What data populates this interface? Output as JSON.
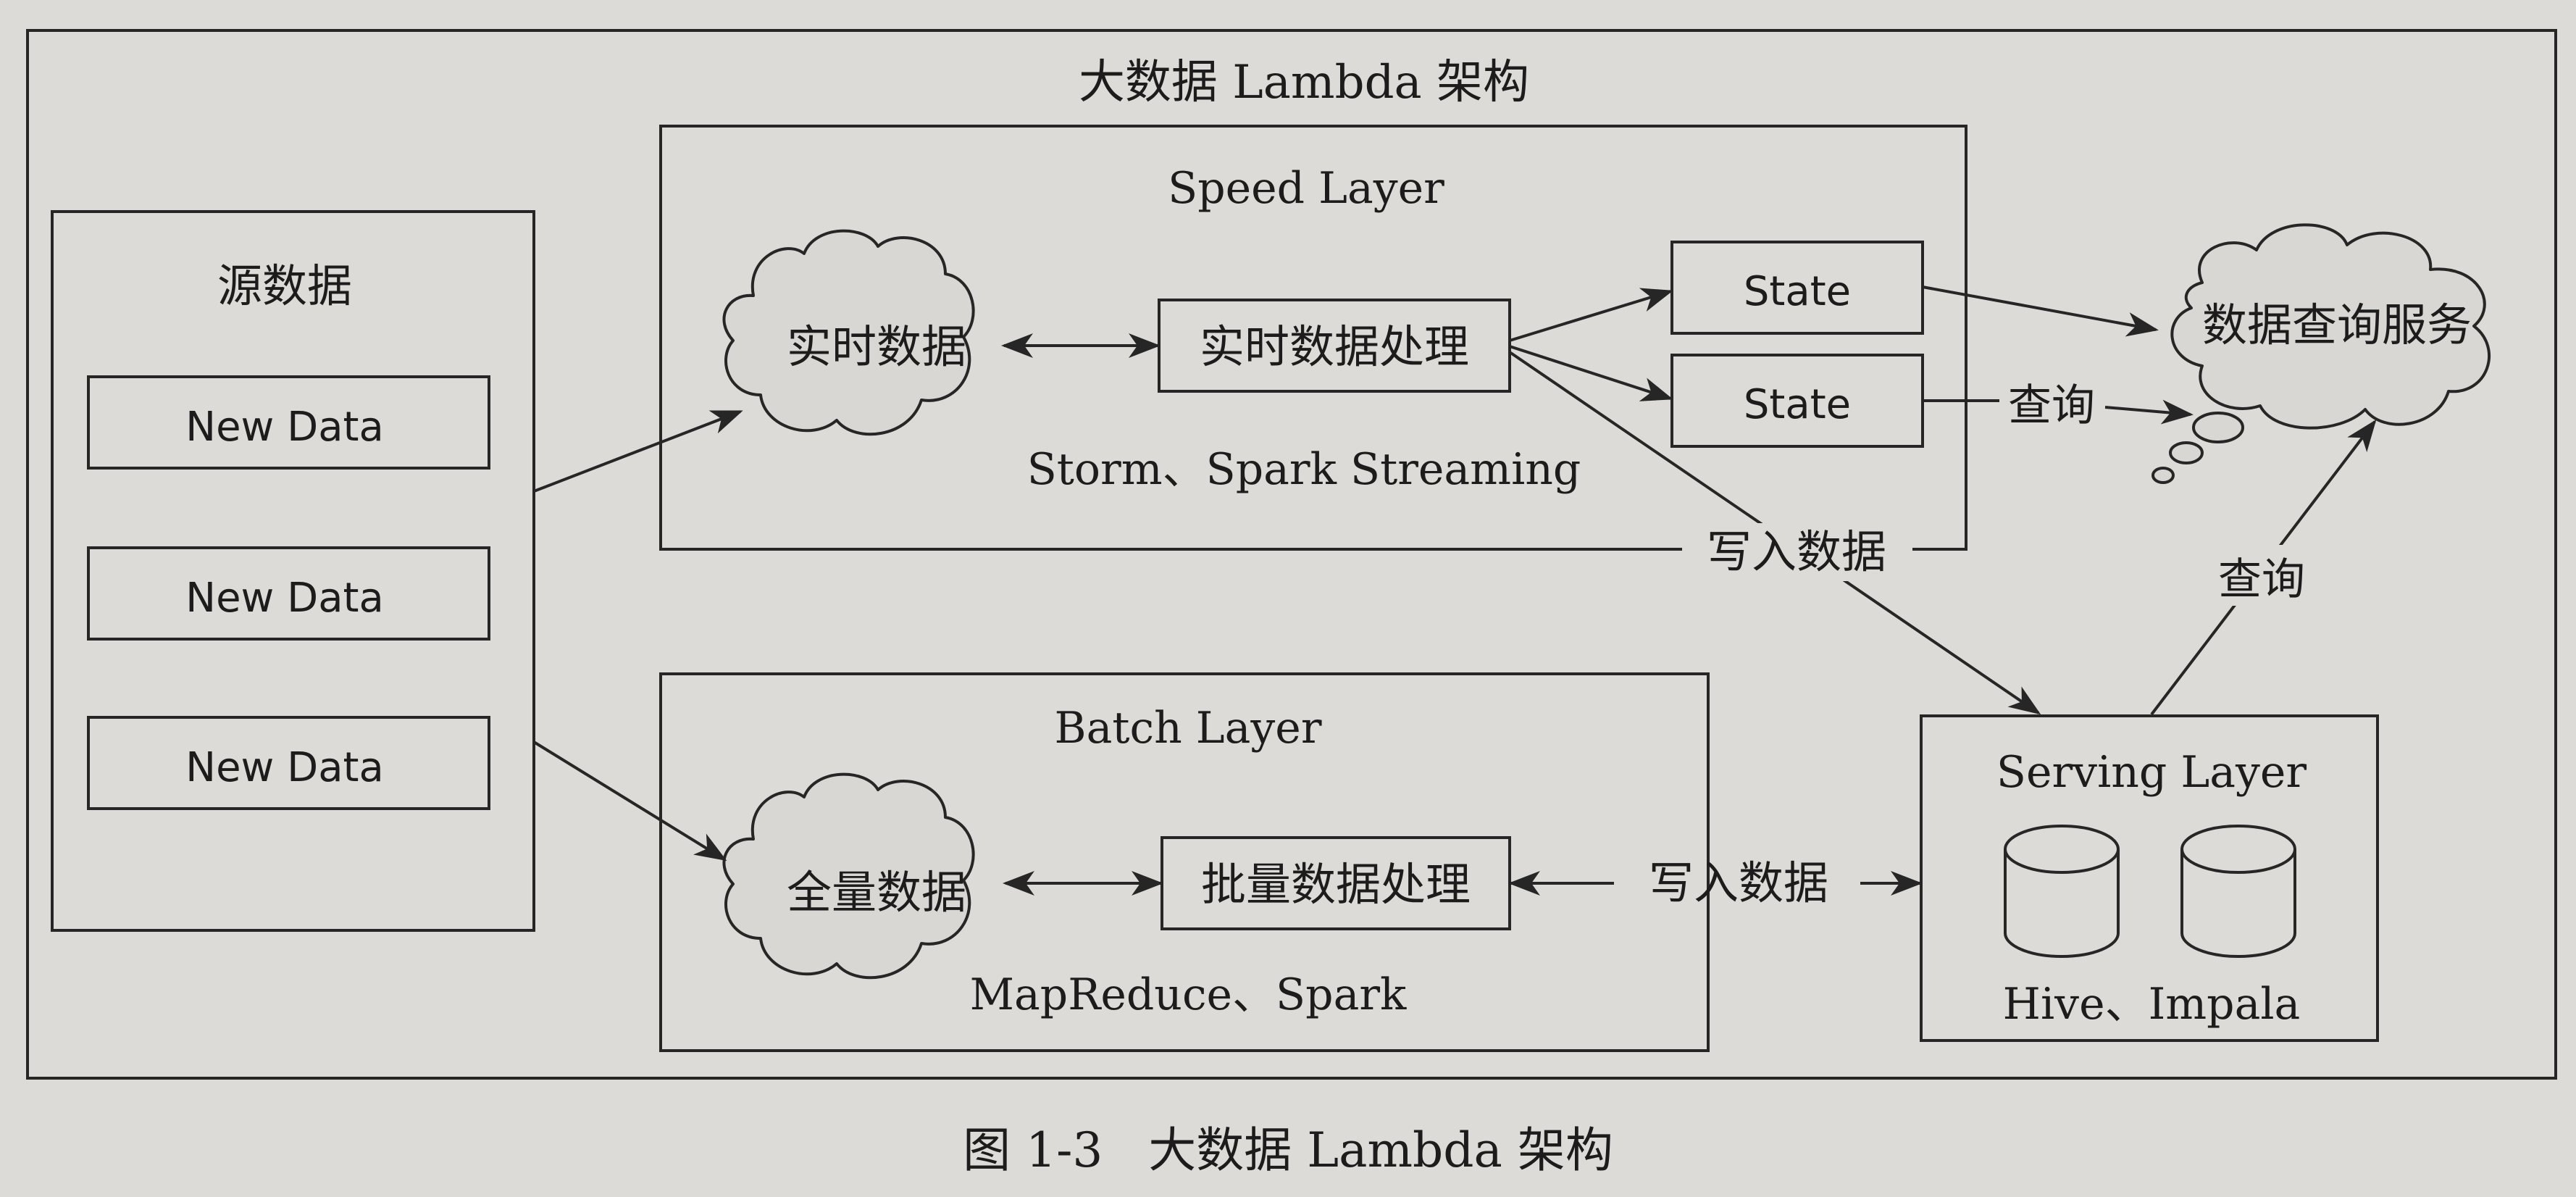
{
  "diagram": {
    "title": "大数据 Lambda 架构",
    "caption": "图 1-3   大数据 Lambda 架构",
    "source": {
      "title": "源数据",
      "items": [
        "New Data",
        "New Data",
        "New Data"
      ]
    },
    "speed_layer": {
      "title": "Speed Layer",
      "cloud_label": "实时数据",
      "process_label": "实时数据处理",
      "tech_label": "Storm、Spark Streaming",
      "state_labels": [
        "State",
        "State"
      ],
      "write_label": "写入数据"
    },
    "query_service": {
      "label": "数据查询服务",
      "query_label_from_state": "查询",
      "query_label_from_serving": "查询"
    },
    "batch_layer": {
      "title": "Batch Layer",
      "cloud_label": "全量数据",
      "process_label": "批量数据处理",
      "tech_label": "MapReduce、Spark",
      "write_label": "写入数据"
    },
    "serving_layer": {
      "title": "Serving Layer",
      "tech_label": "Hive、Impala"
    }
  }
}
